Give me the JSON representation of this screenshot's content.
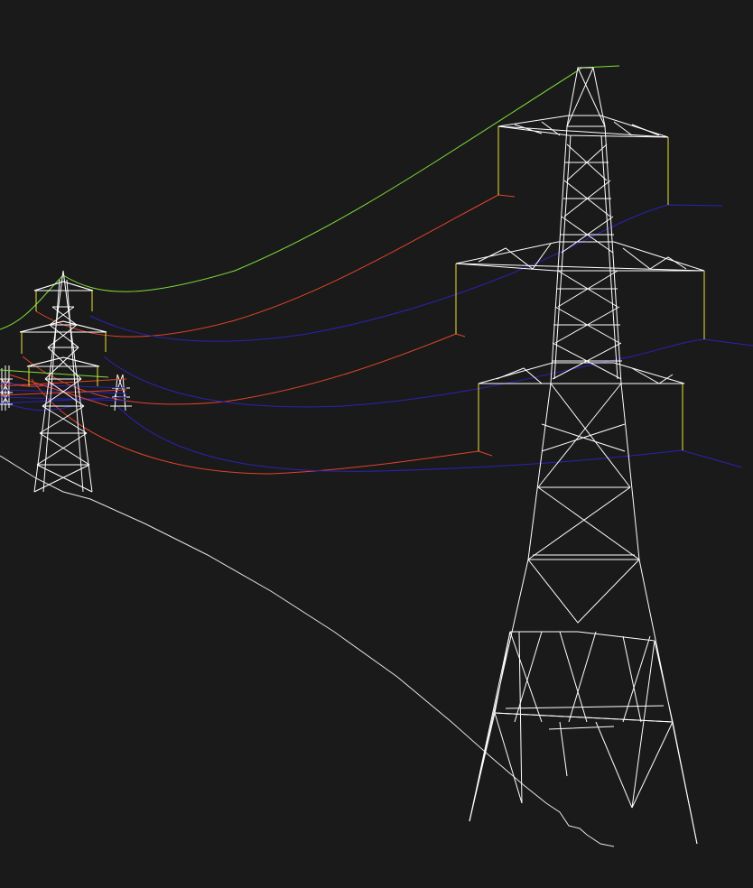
{
  "viewport": {
    "background": "#1a1a1a",
    "colors": {
      "tower": "#ffffff",
      "ground_line": "#e6e6e6",
      "earth_wire": "#7ee03a",
      "phase_red": "#e0442a",
      "phase_blue": "#2a23b5",
      "insulator": "#e8e23a"
    }
  },
  "scene": {
    "objects": [
      {
        "name": "near-pylon",
        "kind": "lattice-tower"
      },
      {
        "name": "far-pylon",
        "kind": "lattice-tower"
      },
      {
        "name": "distant-pylon-cluster",
        "kind": "lattice-tower-group"
      },
      {
        "name": "terrain-profile",
        "kind": "ground-line"
      },
      {
        "name": "overhead-conductors",
        "kind": "catenary-wires"
      }
    ]
  }
}
